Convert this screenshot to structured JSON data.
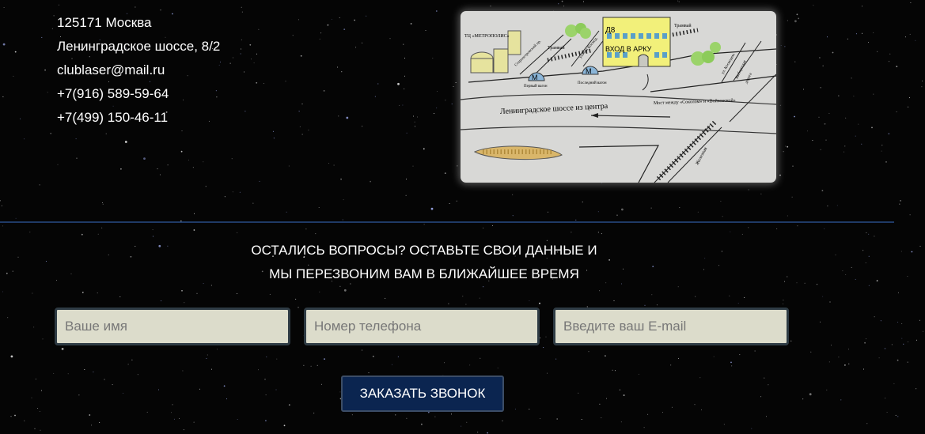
{
  "contacts": {
    "postal": "125171 Москва",
    "street": "Ленинградское шоссе, 8/2",
    "email": "clublaser@mail.ru",
    "phone1": "+7(916) 589-59-64",
    "phone2": "+7(499) 150-46-11"
  },
  "map": {
    "building_number": "Д8",
    "entrance_label": "ВХОД В АРКУ",
    "mall_label": "ТЦ «МЕТРОПОЛИС»",
    "tram_label_1": "Трамвай",
    "tram_label_2": "Трамвай",
    "street_studencheskaya": "Старопетровский пр.",
    "street_zoi": "ул. Зои Космод.",
    "street_kosmo": "ул. Космодем.",
    "street_vodnaya": "Выборгская",
    "road_label": "дорога",
    "railway_label": "Железная",
    "first_car": "Первый вагон",
    "last_car": "Последний вагон",
    "metro_letter": "М",
    "highway_label": "Ленинградское шоссе из центра",
    "bridge_label": "Мост между «Соколом» и «Войковской»"
  },
  "form": {
    "heading_line1": "ОСТАЛИСЬ ВОПРОСЫ? ОСТАВЬТЕ СВОИ ДАННЫЕ И",
    "heading_line2": "МЫ ПЕРЕЗВОНИМ ВАМ В БЛИЖАЙШЕЕ ВРЕМЯ",
    "name_placeholder": "Ваше имя",
    "phone_placeholder": "Номер телефона",
    "email_placeholder": "Введите ваш E-mail",
    "submit_label": "ЗАКАЗАТЬ ЗВОНОК"
  },
  "colors": {
    "background": "#050505",
    "divider": "#1f3a66",
    "button": "#0b2550",
    "field": "#dcdccb",
    "map_background": "#d8d8d6",
    "building": "#f2f07a"
  }
}
